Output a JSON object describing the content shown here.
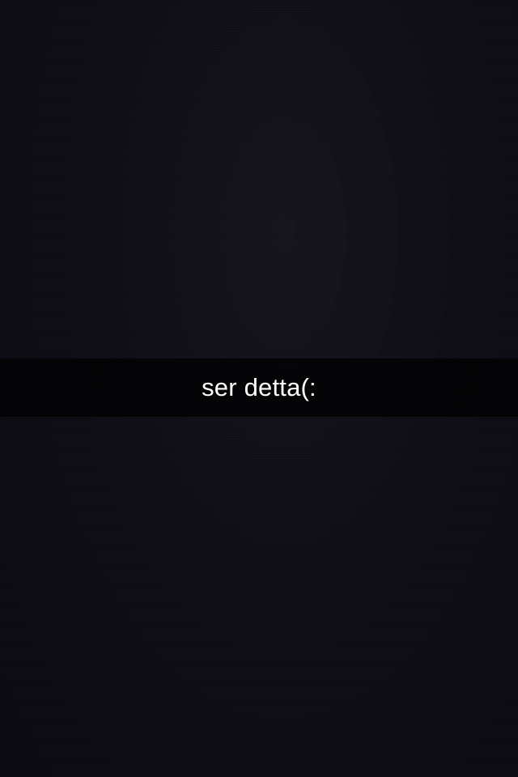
{
  "snap": {
    "caption": "ser detta(:"
  },
  "colors": {
    "background": "#0e0c14",
    "caption_bar": "#000000",
    "caption_text": "#ffffff"
  }
}
